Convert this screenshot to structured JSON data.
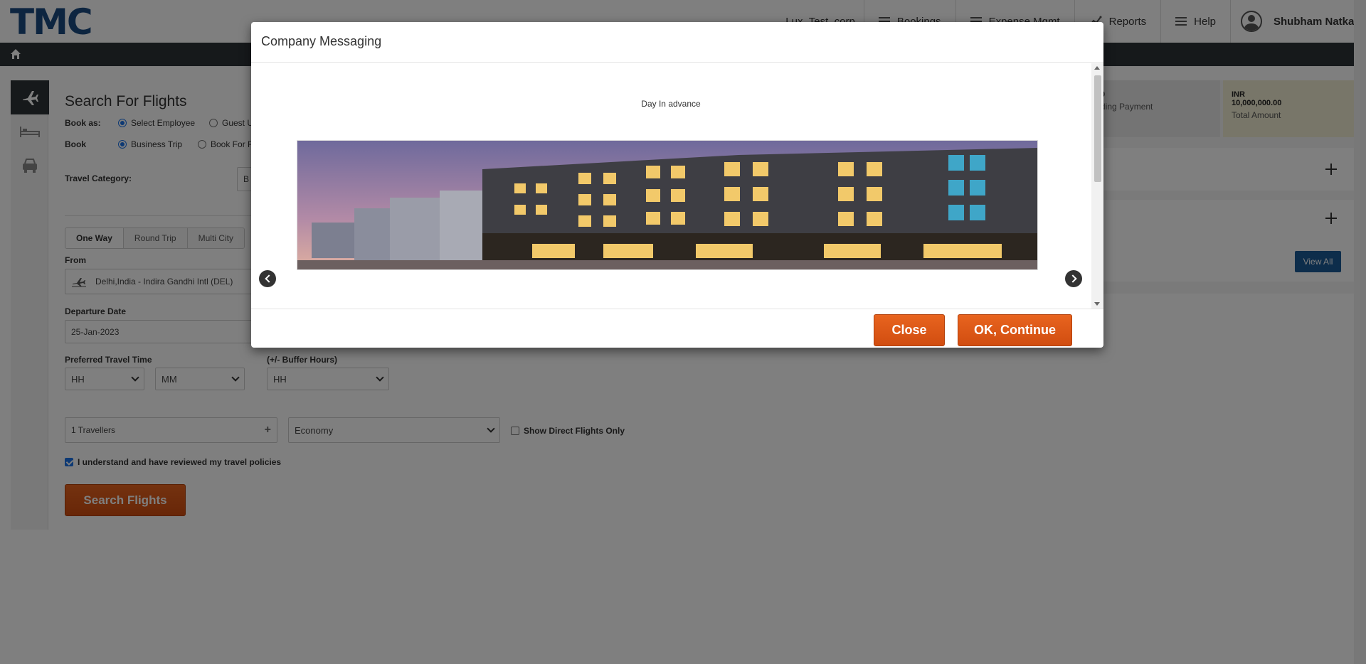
{
  "header": {
    "logo": "TMC",
    "corp_name": "Lux_Test_corp",
    "nav": [
      "Bookings",
      "Expense Mgmt",
      "Reports",
      "Help"
    ],
    "user_name": "Shubham Natkar"
  },
  "side_tabs": [
    "flight-icon",
    "hotel-icon",
    "car-icon"
  ],
  "search": {
    "title": "Search For Flights",
    "book_as_label": "Book as:",
    "book_as_options": [
      "Select Employee",
      "Guest U"
    ],
    "book_label": "Book",
    "book_options": [
      "Business Trip",
      "Book For F"
    ],
    "travel_category_label": "Travel Category:",
    "travel_category_value": "B",
    "trip_tabs": [
      "One Way",
      "Round Trip",
      "Multi City"
    ],
    "from_label": "From",
    "from_value": "Delhi,India - Indira Gandhi Intl (DEL)",
    "departure_label": "Departure Date",
    "departure_value": "25-Jan-2023",
    "pref_time_label": "Preferred Travel Time",
    "hh": "HH",
    "mm": "MM",
    "buffer_label": "(+/- Buffer Hours)",
    "buffer_value": "HH",
    "travellers": "1 Travellers",
    "cabin": "Economy",
    "direct_label": "Show Direct Flights Only",
    "policy_label": "I understand and have reviewed my travel policies",
    "search_button": "Search Flights"
  },
  "right": {
    "pending_value": "0",
    "pending_label": "ding Payment",
    "total_currency": "INR",
    "total_value": "10,000,000.00",
    "total_label": "Total Amount",
    "view_all": "View All"
  },
  "modal": {
    "title": "Company Messaging",
    "message": "Day In advance",
    "close_button": "Close",
    "continue_button": "OK, Continue"
  },
  "colors": {
    "brand": "#1a4a80",
    "accent_orange": "#d9531a",
    "dark_bar": "#2d3337",
    "blue_button": "#1b5a96"
  }
}
